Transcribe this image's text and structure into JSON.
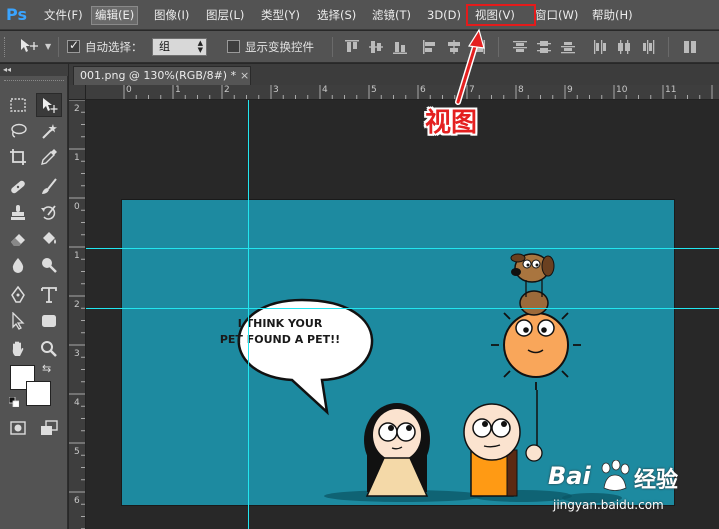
{
  "app": {
    "logo": "Ps"
  },
  "menu": {
    "items": [
      {
        "label": "文件(F)"
      },
      {
        "label": "编辑(E)"
      },
      {
        "label": "图像(I)"
      },
      {
        "label": "图层(L)"
      },
      {
        "label": "类型(Y)"
      },
      {
        "label": "选择(S)"
      },
      {
        "label": "滤镜(T)"
      },
      {
        "label": "3D(D)"
      },
      {
        "label": "视图(V)"
      },
      {
        "label": "窗口(W)"
      },
      {
        "label": "帮助(H)"
      }
    ],
    "active_index": 1,
    "highlighted_index": 8
  },
  "options_bar": {
    "auto_select_label": "自动选择：",
    "auto_select_checked": true,
    "auto_select_value": "组",
    "show_transform_label": "显示变换控件",
    "show_transform_checked": false
  },
  "document": {
    "tab_title": "001.png @ 130%(RGB/8#) *",
    "close_glyph": "×"
  },
  "rulers": {
    "horizontal": [
      "0",
      "1",
      "2",
      "3",
      "4",
      "5",
      "6",
      "7",
      "8",
      "9",
      "10",
      "11"
    ],
    "vertical": [
      "2",
      "1",
      "0",
      "1",
      "2",
      "3",
      "4",
      "5",
      "6"
    ]
  },
  "canvas": {
    "bubble_line1": "I THINK YOUR",
    "bubble_line2": "PET FOUND A PET!!",
    "background_color": "#1d8aa0"
  },
  "annotation": {
    "text": "视图",
    "color": "#e42020"
  },
  "watermark": {
    "brand_left": "Bai",
    "brand_right": "经验",
    "url": "jingyan.baidu.com"
  },
  "colors": {
    "accent_ps": "#3aa4ff",
    "guide": "#22e6f0",
    "highlight_box": "#e41b1b"
  },
  "icons": {
    "tools": [
      "marquee-icon",
      "move-icon",
      "lasso-icon",
      "magic-wand-icon",
      "crop-icon",
      "eyedropper-icon",
      "healing-brush-icon",
      "brush-icon",
      "clone-stamp-icon",
      "history-brush-icon",
      "eraser-icon",
      "paint-bucket-icon",
      "blur-icon",
      "dodge-icon",
      "pen-icon",
      "type-icon",
      "path-select-icon",
      "rectangle-icon",
      "hand-icon",
      "zoom-icon",
      "quick-mask-icon",
      "screen-mode-icon"
    ]
  }
}
